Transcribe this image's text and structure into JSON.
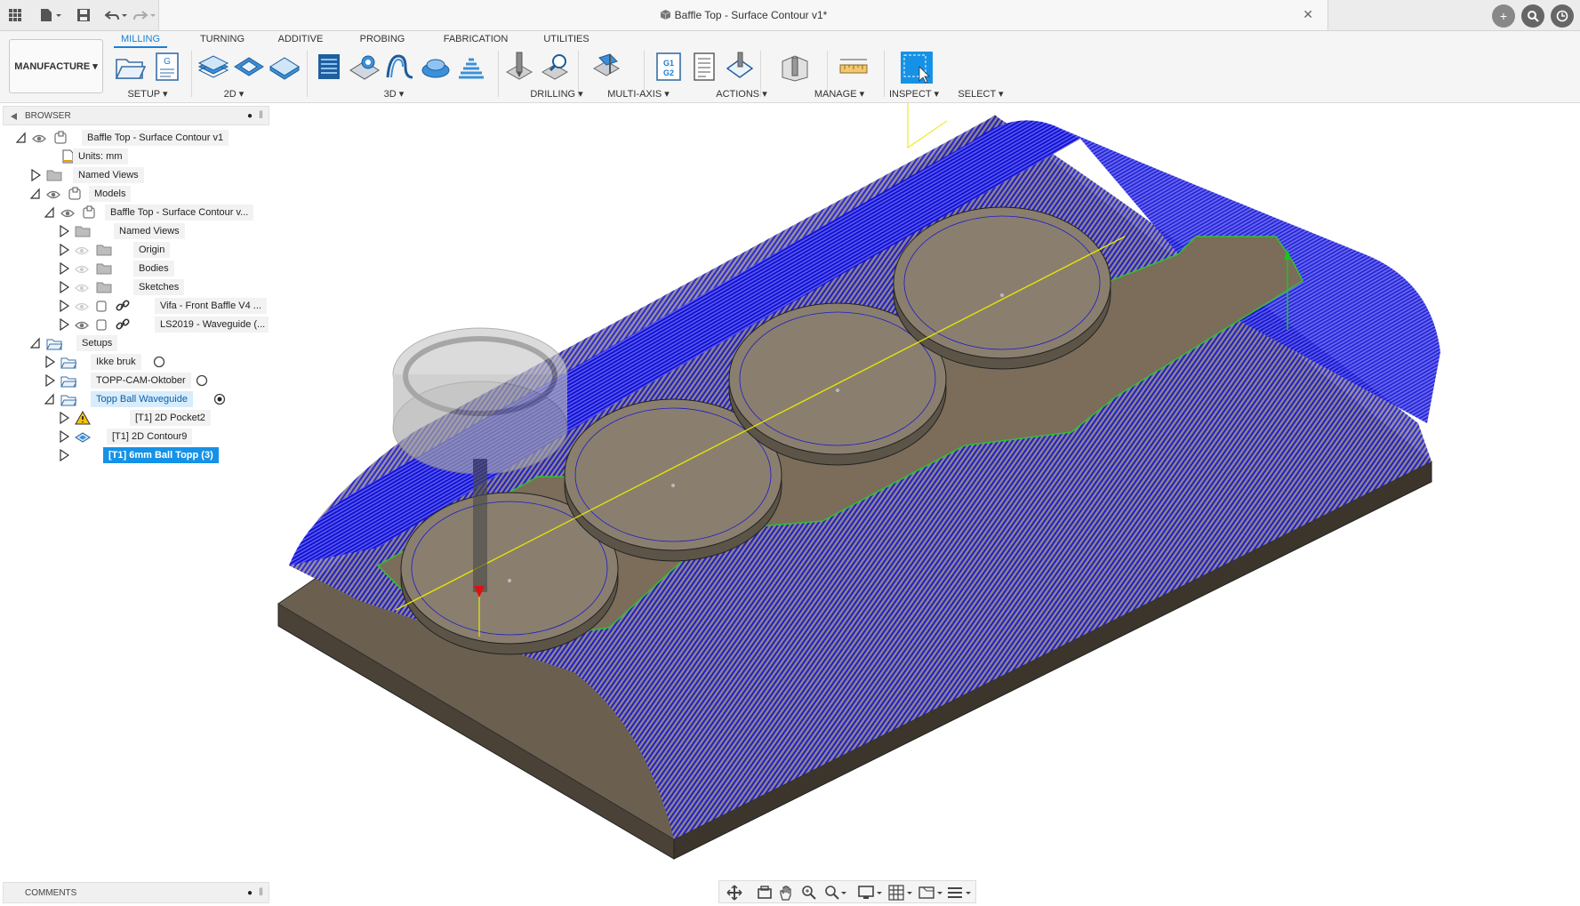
{
  "window": {
    "doc_title": "Baffle Top - Surface Contour v1*"
  },
  "workspace": {
    "label": "MANUFACTURE ▾"
  },
  "tabs": [
    {
      "label": "MILLING",
      "active": true
    },
    {
      "label": "TURNING"
    },
    {
      "label": "ADDITIVE"
    },
    {
      "label": "PROBING"
    },
    {
      "label": "FABRICATION"
    },
    {
      "label": "UTILITIES"
    }
  ],
  "groups": [
    {
      "label": "SETUP ▾"
    },
    {
      "label": "2D ▾"
    },
    {
      "label": "3D ▾"
    },
    {
      "label": "DRILLING ▾"
    },
    {
      "label": "MULTI-AXIS ▾"
    },
    {
      "label": "ACTIONS ▾"
    },
    {
      "label": "MANAGE ▾"
    },
    {
      "label": "INSPECT ▾"
    },
    {
      "label": "SELECT ▾"
    }
  ],
  "browser": {
    "title": "BROWSER",
    "nodes": [
      {
        "label": "Baffle Top - Surface Contour v1"
      },
      {
        "label": "Units: mm"
      },
      {
        "label": "Named Views"
      },
      {
        "label": "Models"
      },
      {
        "label": "Baffle Top - Surface Contour v..."
      },
      {
        "label": "Named Views"
      },
      {
        "label": "Origin"
      },
      {
        "label": "Bodies"
      },
      {
        "label": "Sketches"
      },
      {
        "label": "Vifa - Front Baffle V4 ..."
      },
      {
        "label": "LS2019 - Waveguide (..."
      },
      {
        "label": "Setups"
      },
      {
        "label": "Ikke bruk"
      },
      {
        "label": "TOPP-CAM-Oktober"
      },
      {
        "label": "Topp Ball Waveguide"
      },
      {
        "label": "[T1] 2D Pocket2"
      },
      {
        "label": "[T1] 2D Contour9"
      },
      {
        "label": "[T1] 6mm Ball Topp (3)"
      }
    ]
  },
  "comments": {
    "title": "COMMENTS"
  },
  "colors": {
    "accent": "#1b7fd6",
    "selection": "#1592e6",
    "toolpath": "#1a1acc",
    "stock": "#6b6050",
    "boundary": "#2fc02f",
    "axis_line": "#e8e800"
  }
}
